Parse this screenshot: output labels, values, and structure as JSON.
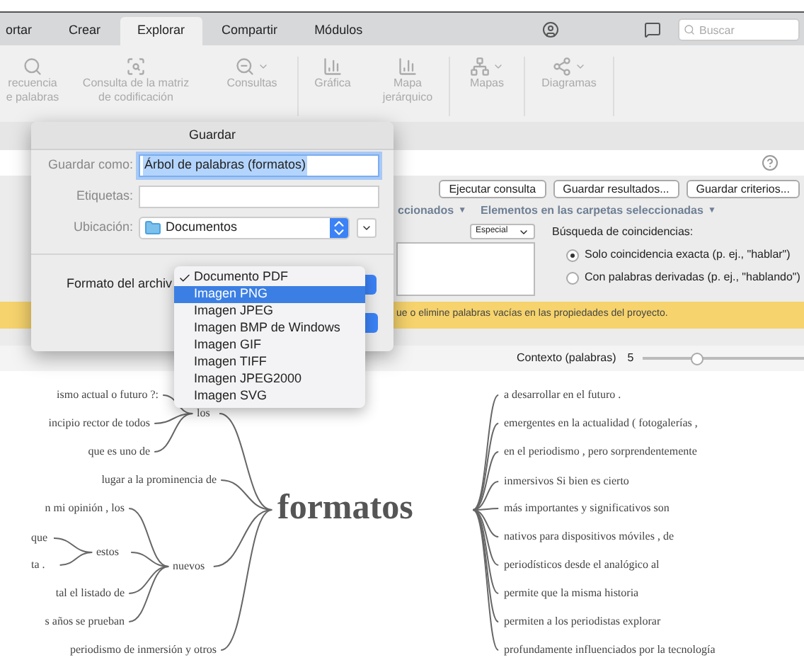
{
  "tabs": [
    {
      "label": "ortar",
      "selected": false
    },
    {
      "label": "Crear",
      "selected": false
    },
    {
      "label": "Explorar",
      "selected": true
    },
    {
      "label": "Compartir",
      "selected": false
    },
    {
      "label": "Módulos",
      "selected": false
    }
  ],
  "search": {
    "placeholder": "Buscar"
  },
  "ribbon": [
    {
      "lines": [
        "recuencia",
        "e palabras"
      ],
      "kind": "search",
      "dropdown": false,
      "disabled": true
    },
    {
      "lines": [
        "Consulta de la matriz",
        "de codificación"
      ],
      "kind": "scan",
      "dropdown": false,
      "disabled": true
    },
    {
      "lines": [
        "Consultas"
      ],
      "kind": "zoom",
      "dropdown": true,
      "disabled": true
    },
    {
      "lines": [
        "Gráfica"
      ],
      "kind": "chart",
      "dropdown": false,
      "disabled": true
    },
    {
      "lines": [
        "Mapa",
        "jerárquico"
      ],
      "kind": "chart",
      "dropdown": false,
      "disabled": true
    },
    {
      "lines": [
        "Mapas"
      ],
      "kind": "hierarchy",
      "dropdown": true,
      "disabled": true
    },
    {
      "lines": [
        "Diagramas"
      ],
      "kind": "network",
      "dropdown": true,
      "disabled": true
    }
  ],
  "query": {
    "buttons": [
      "Ejecutar consulta",
      "Guardar resultados...",
      "Guardar criterios..."
    ],
    "menus": [
      {
        "label": "ccionados",
        "caret": "▼"
      },
      {
        "label": "Elementos en las carpetas seleccionadas",
        "caret": "▼"
      }
    ],
    "select": "Especial",
    "match_label": "Búsqueda de coincidencias:",
    "radios": [
      {
        "label": "Solo coincidencia exacta (p. ej., \"hablar\")",
        "selected": true
      },
      {
        "label": "Con palabras derivadas (p. ej., \"hablando\")",
        "selected": false
      }
    ],
    "warning": "ue o elimine palabras vacías en las propiedades del proyecto.",
    "context": {
      "label": "Contexto (palabras)",
      "value": "5",
      "level": 0.3
    }
  },
  "dialog": {
    "title": "Guardar",
    "fields": [
      {
        "label": "Guardar como:",
        "value": "Árbol de palabras (formatos)",
        "selected": true
      },
      {
        "label": "Etiquetas:",
        "selected": false
      }
    ],
    "location": {
      "label": "Ubicación:",
      "value": "Documentos"
    },
    "format_label": "Formato del archiv",
    "format_menu": [
      {
        "label": "Documento PDF",
        "checked": true,
        "selected": false
      },
      {
        "label": "Imagen PNG",
        "checked": false,
        "selected": true
      },
      {
        "label": "Imagen JPEG",
        "checked": false,
        "selected": false
      },
      {
        "label": "Imagen BMP de Windows",
        "checked": false,
        "selected": false
      },
      {
        "label": "Imagen GIF",
        "checked": false,
        "selected": false
      },
      {
        "label": "Imagen TIFF",
        "checked": false,
        "selected": false
      },
      {
        "label": "Imagen JPEG2000",
        "checked": false,
        "selected": false
      },
      {
        "label": "Imagen SVG",
        "checked": false,
        "selected": false
      }
    ]
  },
  "word_tree": {
    "root": "formatos",
    "left": [
      {
        "text": "los",
        "children": [
          {
            "text": "ismo actual o futuro ?:"
          },
          {
            "text": "incipio rector de todos"
          },
          {
            "text": "que es uno de"
          }
        ]
      },
      {
        "text": "lugar a la prominencia de"
      },
      {
        "text": "nuevos",
        "children": [
          {
            "text": "n mi opinión , los"
          },
          {
            "text": "estos",
            "children": [
              {
                "text": "que"
              },
              {
                "text": "ta ."
              }
            ]
          },
          {
            "text": "tal el listado de"
          },
          {
            "text": "s años se prueban"
          }
        ]
      },
      {
        "text": "periodismo de inmersión y otros"
      }
    ],
    "right": [
      "a desarrollar en el futuro .",
      "emergentes en la actualidad ( fotogalerías ,",
      "en el periodismo , pero sorprendentemente",
      "inmersivos Si bien es cierto",
      "más importantes y significativos son",
      "nativos para dispositivos móviles , de",
      "periodísticos desde el analógico al",
      "permite que la misma historia",
      "permiten a los periodistas explorar",
      "profundamente influenciados por la tecnología"
    ]
  }
}
